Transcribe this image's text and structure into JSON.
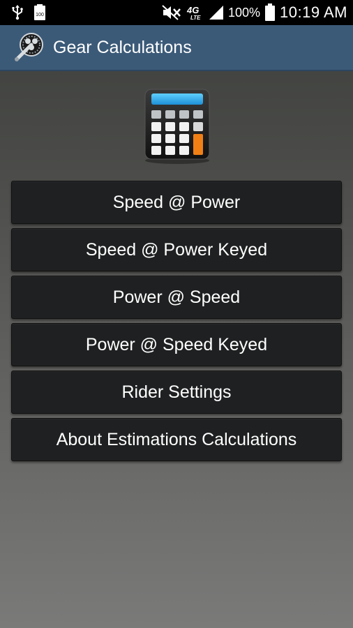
{
  "status_bar": {
    "battery_small": "100",
    "network": "4G LTE",
    "battery_pct": "100%",
    "time": "10:19 AM",
    "icons": [
      "usb-icon",
      "battery-notice-icon",
      "mute-icon",
      "signal-icon",
      "battery-icon"
    ]
  },
  "app_bar": {
    "title": "Gear Calculations",
    "icon": "gear-crank-icon",
    "color": "#3b5a78"
  },
  "hero": {
    "icon": "calculator-icon"
  },
  "menu": {
    "items": [
      {
        "label": "Speed @ Power"
      },
      {
        "label": "Speed @ Power Keyed"
      },
      {
        "label": "Power @ Speed"
      },
      {
        "label": "Power @ Speed Keyed"
      },
      {
        "label": "Rider Settings"
      },
      {
        "label": "About Estimations Calculations"
      }
    ]
  }
}
